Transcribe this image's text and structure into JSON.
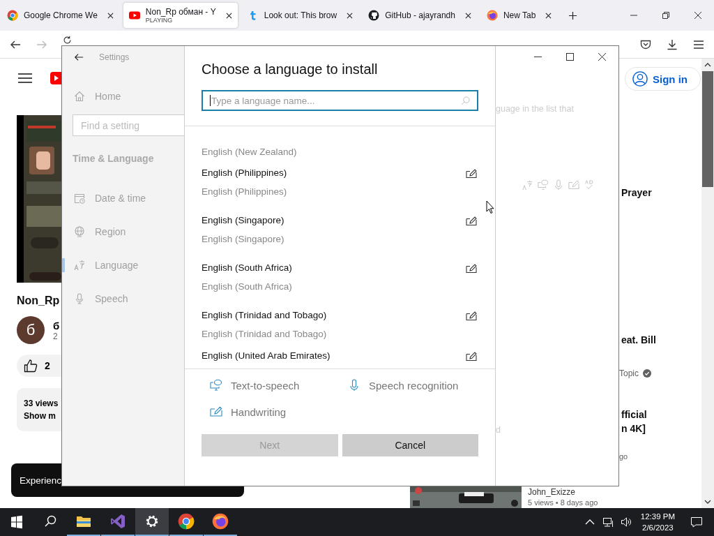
{
  "browser": {
    "tabs": [
      {
        "title": "Google Chrome We",
        "selected": false
      },
      {
        "title": "Non_Rp обман - Y",
        "subtitle": "PLAYING",
        "selected": true
      },
      {
        "title": "Look out: This brow",
        "selected": false
      },
      {
        "title": "GitHub - ajayrandh",
        "selected": false
      },
      {
        "title": "New Tab",
        "selected": false
      }
    ]
  },
  "page": {
    "left": {
      "video_title": "Non_Rp",
      "avatar_letter": "б",
      "channel": "б",
      "subscribers": "2",
      "likes": "2",
      "views": "33 views",
      "show_more": "Show m",
      "toast": "Experienc"
    },
    "right": {
      "sign_in": "Sign in",
      "texts": [
        {
          "text": "Prayer",
          "kind": "title"
        },
        {
          "text": "eat. Bill",
          "kind": "title"
        },
        {
          "text": "Topic",
          "kind": "verified"
        },
        {
          "text": "fficial",
          "kind": "title"
        },
        {
          "text": "n 4K]",
          "kind": "title"
        },
        {
          "text": "go",
          "kind": "meta"
        }
      ],
      "bottom_video": {
        "channel": "John_Exizze",
        "meta": "5 views  • 8 days ago"
      }
    }
  },
  "settings": {
    "title": "Settings",
    "nav": {
      "home": "Home",
      "search_placeholder": "Find a setting",
      "section": "Time & Language",
      "items": [
        {
          "label": "Date & time",
          "selected": false
        },
        {
          "label": "Region",
          "selected": false
        },
        {
          "label": "Language",
          "selected": true
        },
        {
          "label": "Speech",
          "selected": false
        }
      ]
    },
    "behind": {
      "hint": "guage in the list that",
      "fragment": "d"
    },
    "dialog": {
      "title": "Choose a language to install",
      "search_placeholder": "Type a language name...",
      "languages": [
        {
          "native": "English (New Zealand)"
        },
        {
          "name": "English (Philippines)",
          "native": "English (Philippines)"
        },
        {
          "name": "English (Singapore)",
          "native": "English (Singapore)"
        },
        {
          "name": "English (South Africa)",
          "native": "English (South Africa)"
        },
        {
          "name": "English (Trinidad and Tobago)",
          "native": "English (Trinidad and Tobago)"
        },
        {
          "name": "English (United Arab Emirates)"
        }
      ],
      "features": [
        {
          "label": "Text-to-speech",
          "kind": "tts"
        },
        {
          "label": "Speech recognition",
          "kind": "speech"
        },
        {
          "label": "Handwriting",
          "kind": "handwriting"
        }
      ],
      "buttons": [
        {
          "label": "Next",
          "disabled": true
        },
        {
          "label": "Cancel",
          "disabled": false
        }
      ]
    }
  },
  "taskbar": {
    "apps": [
      {
        "kind": "explorer",
        "selected": false
      },
      {
        "kind": "studio",
        "selected": false
      },
      {
        "kind": "settings",
        "selected": true
      },
      {
        "kind": "chrome",
        "selected": false
      },
      {
        "kind": "firefox",
        "selected": false
      }
    ],
    "time": "12:39 PM",
    "date": "2/6/2023"
  }
}
